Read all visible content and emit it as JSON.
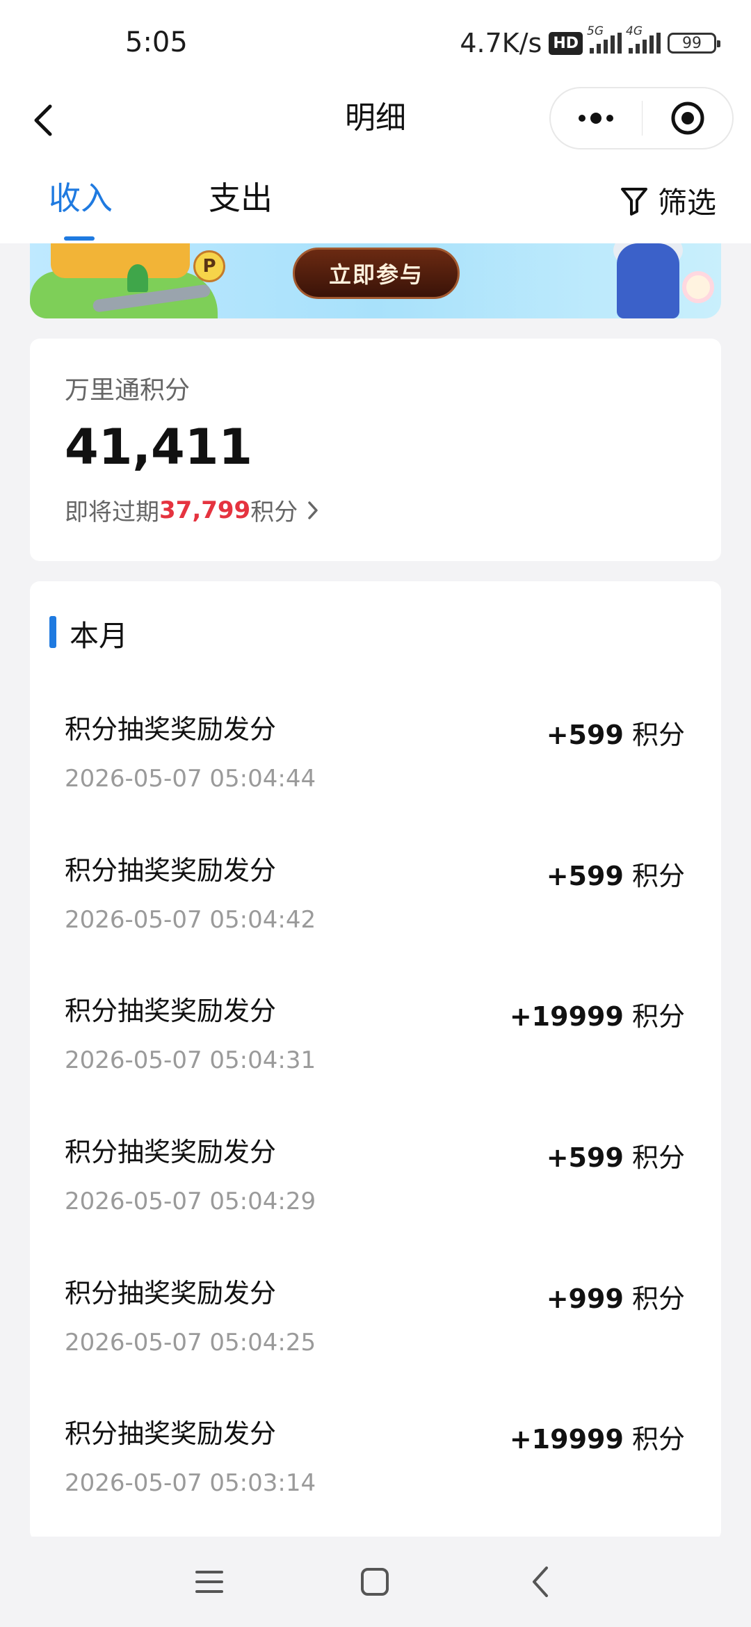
{
  "status_bar": {
    "time": "5:05",
    "net_speed": "4.7K/s",
    "hd_label": "HD",
    "sim1_label": "5G",
    "sim2_label": "4G",
    "battery": "99"
  },
  "header": {
    "title": "明细",
    "back_icon": "back-chevron-icon",
    "more_icon": "more-dots-icon",
    "target_icon": "close-target-icon"
  },
  "tabs": {
    "items": [
      {
        "label": "收入",
        "active": true
      },
      {
        "label": "支出",
        "active": false
      }
    ],
    "filter_label": "筛选",
    "filter_icon": "funnel-icon",
    "accent_color": "#1f7ae0"
  },
  "banner": {
    "button_label": "立即参与",
    "p_sign": "P"
  },
  "points": {
    "label": "万里通积分",
    "value": "41,411",
    "expire_prefix": "即将过期",
    "expire_value": "37,799",
    "expire_suffix": "积分",
    "expire_color": "#e5333f"
  },
  "records": {
    "month_title": "本月",
    "unit": "积分",
    "items": [
      {
        "title": "积分抽奖奖励发分",
        "time": "2026-05-07 05:04:44",
        "amount": "+599"
      },
      {
        "title": "积分抽奖奖励发分",
        "time": "2026-05-07 05:04:42",
        "amount": "+599"
      },
      {
        "title": "积分抽奖奖励发分",
        "time": "2026-05-07 05:04:31",
        "amount": "+19999"
      },
      {
        "title": "积分抽奖奖励发分",
        "time": "2026-05-07 05:04:29",
        "amount": "+599"
      },
      {
        "title": "积分抽奖奖励发分",
        "time": "2026-05-07 05:04:25",
        "amount": "+999"
      },
      {
        "title": "积分抽奖奖励发分",
        "time": "2026-05-07 05:03:14",
        "amount": "+19999"
      }
    ]
  },
  "nav_bar": {
    "menu_icon": "menu-icon",
    "home_icon": "home-square-icon",
    "back_icon": "back-triangle-icon"
  }
}
